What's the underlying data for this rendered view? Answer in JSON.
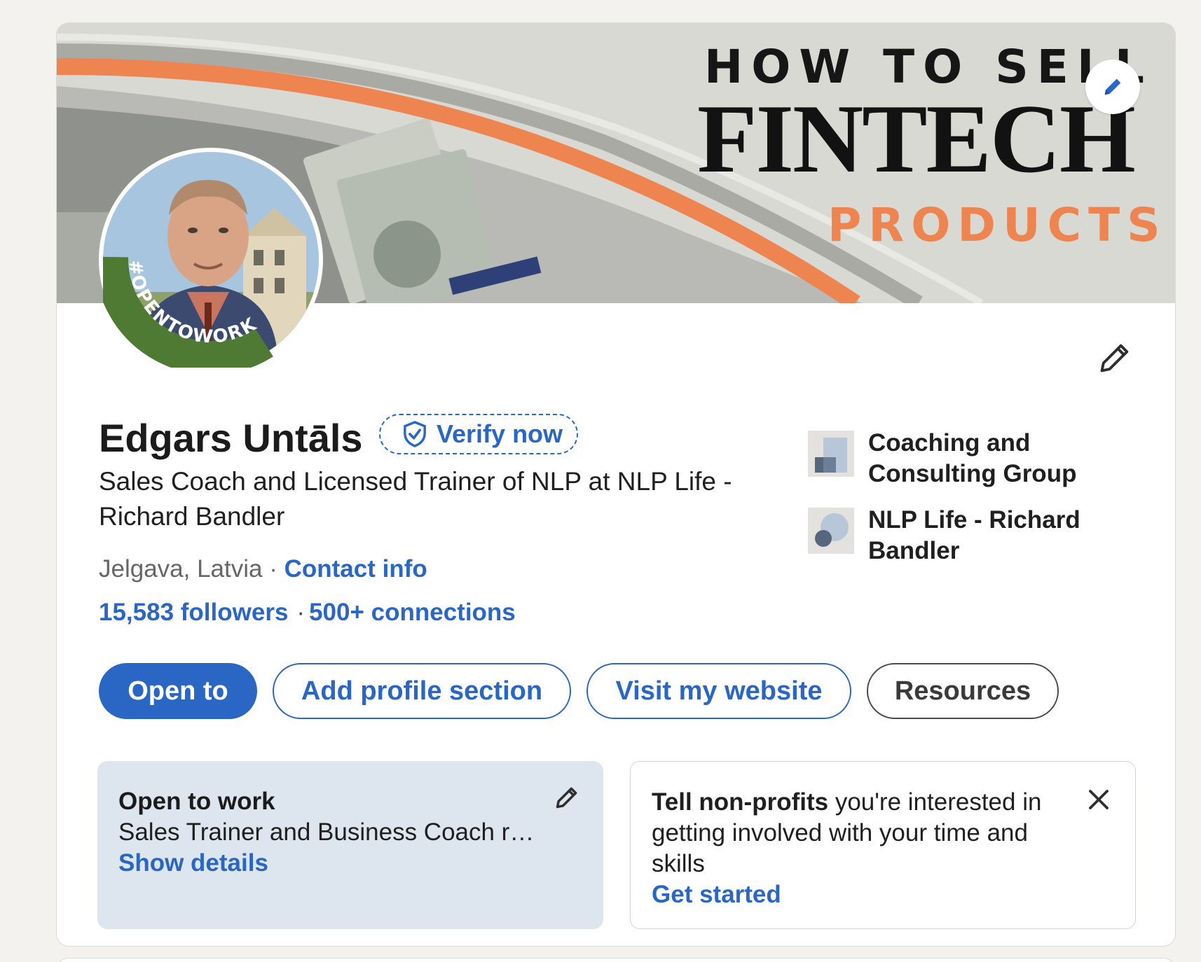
{
  "banner": {
    "line1": "HOW TO SELL",
    "line2": "FINTECH",
    "line3": "PRODUCTS",
    "edit_icon": "pencil-icon",
    "colors": {
      "orange": "#ee8550",
      "grey": "#a9aaa3",
      "background": "#d8d8d3"
    }
  },
  "avatar": {
    "badge_text": "#OPENTOWORK",
    "badge_color": "#4e7a34"
  },
  "profile": {
    "name": "Edgars Untāls",
    "verify_label": "Verify now",
    "verify_icon": "shield-check-icon",
    "headline": "Sales Coach and Licensed Trainer of NLP at NLP Life - Richard Bandler",
    "location": "Jelgava, Latvia",
    "location_sep": " · ",
    "contact_label": "Contact info",
    "followers": "15,583 followers",
    "stats_sep": "·",
    "connections": "500+ connections",
    "edit_icon": "pencil-icon"
  },
  "organizations": [
    {
      "name": "Coaching and Consulting Group",
      "logo_icon": "company-logo-icon"
    },
    {
      "name": "NLP Life - Richard Bandler",
      "logo_icon": "school-logo-icon"
    }
  ],
  "actions": {
    "open_to": "Open to",
    "add_section": "Add profile section",
    "visit_website": "Visit my website",
    "resources": "Resources"
  },
  "open_to_work": {
    "title": "Open to work",
    "subtitle": "Sales Trainer and Business Coach ro...",
    "link": "Show details",
    "edit_icon": "pencil-icon"
  },
  "nonprofit": {
    "bold": "Tell non-profits",
    "rest": " you're interested in getting involved with your time and skills",
    "link": "Get started",
    "close_icon": "close-icon"
  },
  "colors": {
    "accent": "#2a66c4",
    "page_bg": "#f4f2ee"
  }
}
